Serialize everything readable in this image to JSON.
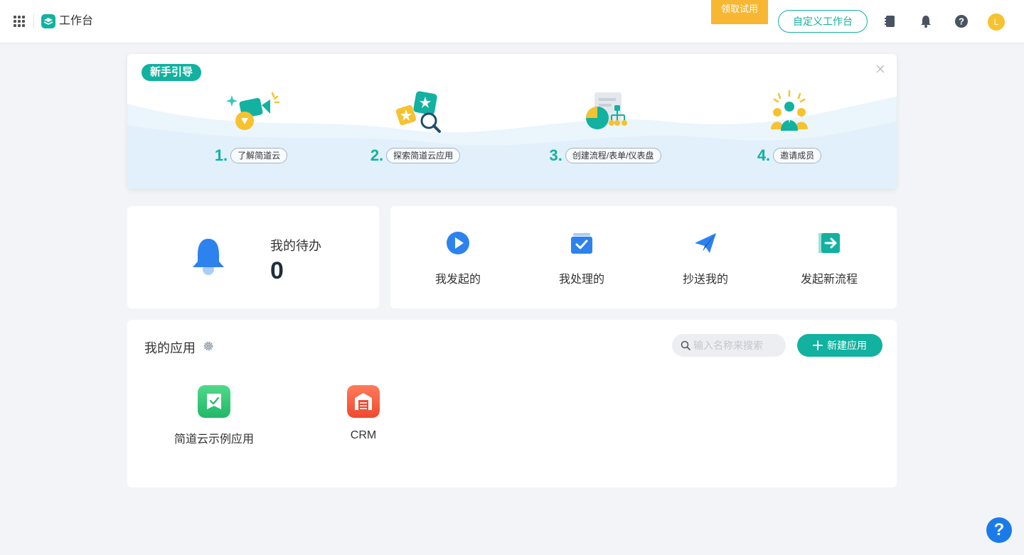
{
  "header": {
    "title": "工作台",
    "trial_label": "领取试用",
    "customize_label": "自定义工作台",
    "avatar_initial": "L"
  },
  "guide": {
    "tag": "新手引导",
    "steps": [
      {
        "num": "1.",
        "label": "了解简道云"
      },
      {
        "num": "2.",
        "label": "探索简道云应用"
      },
      {
        "num": "3.",
        "label": "创建流程/表单/仪表盘"
      },
      {
        "num": "4.",
        "label": "邀请成员"
      }
    ]
  },
  "todo": {
    "label": "我的待办",
    "count": "0"
  },
  "flows": [
    {
      "label": "我发起的",
      "icon": "play-circle-icon"
    },
    {
      "label": "我处理的",
      "icon": "checkbox-tray-icon"
    },
    {
      "label": "抄送我的",
      "icon": "paper-plane-icon"
    },
    {
      "label": "发起新流程",
      "icon": "enter-door-icon"
    }
  ],
  "apps": {
    "title": "我的应用",
    "search_placeholder": "输入名称来搜索",
    "new_label": "新建应用",
    "items": [
      {
        "name": "简道云示例应用",
        "color": "#2ec46e"
      },
      {
        "name": "CRM",
        "color": "#f05a3b"
      }
    ]
  },
  "help_label": "?",
  "colors": {
    "accent": "#12b1a0",
    "blue": "#1a7be8",
    "trial": "#f7b733"
  }
}
